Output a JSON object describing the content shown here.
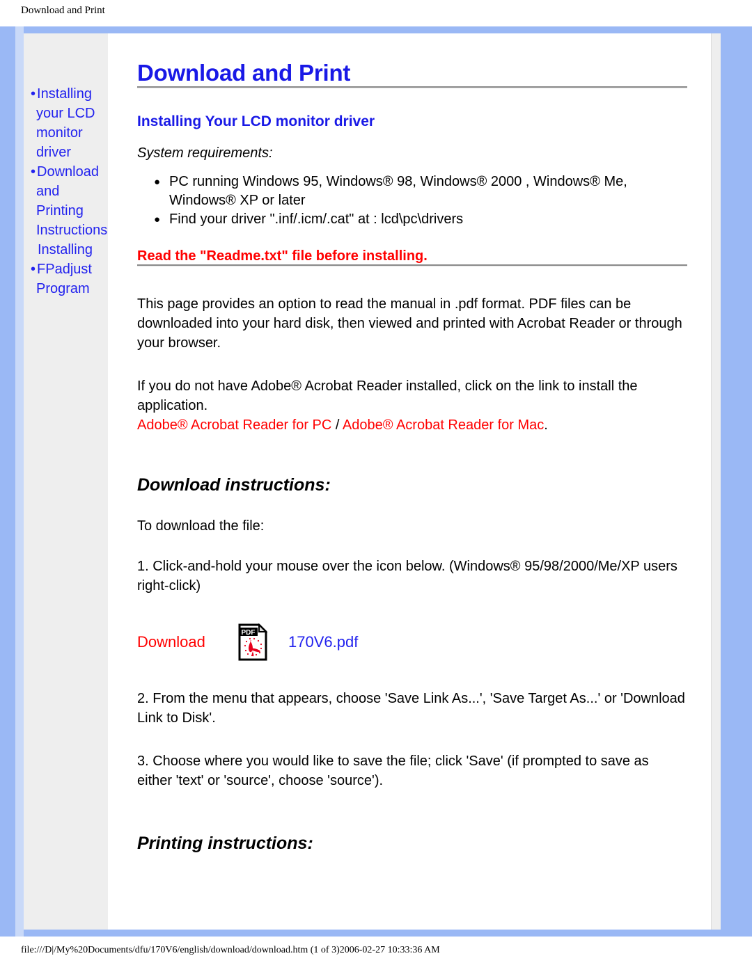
{
  "document_header": "Download and Print",
  "colors": {
    "frame_blue": "#9ab8f5",
    "link_blue": "#2222ee",
    "heading_blue": "#1919e6",
    "warning_red": "#ff0000",
    "sidebar_grey": "#eeeeee"
  },
  "sidebar": {
    "items": [
      {
        "label": "Installing your LCD monitor driver"
      },
      {
        "label": "Download and Printing Instructions"
      },
      {
        "label": "FPadjust Program"
      }
    ],
    "extra_link": "Installing"
  },
  "main": {
    "title": "Download and Print",
    "section_heading": "Installing Your LCD monitor driver",
    "system_requirements_label": "System requirements:",
    "requirements": [
      "PC running Windows 95, Windows® 98, Windows® 2000 , Windows® Me, Windows® XP or later",
      "Find your driver \".inf/.icm/.cat\" at : lcd\\pc\\drivers"
    ],
    "readme_warning": "Read the \"Readme.txt\" file before installing.",
    "intro_paragraph": "This page provides an option to read the manual in .pdf format. PDF files can be downloaded into your hard disk, then viewed and printed with Acrobat Reader or through your browser.",
    "acrobat_paragraph": "If you do not have Adobe® Acrobat Reader installed, click on the link to install the application.",
    "acrobat_links": {
      "pc": "Adobe® Acrobat Reader for PC",
      "separator": " / ",
      "mac": "Adobe® Acrobat Reader for Mac",
      "period": "."
    },
    "download_instructions_heading": "Download instructions:",
    "download_lead": "To download the file:",
    "download_step_1": "1. Click-and-hold your mouse over the icon below. (Windows® 95/98/2000/Me/XP users right-click)",
    "download_link": {
      "label": "Download",
      "icon": "pdf-file-icon",
      "icon_badge": "PDF",
      "filename": "170V6.pdf"
    },
    "download_step_2": "2. From the menu that appears, choose 'Save Link As...', 'Save Target As...' or 'Download Link to Disk'.",
    "download_step_3": "3. Choose where you would like to save the file; click 'Save' (if prompted to save as either 'text' or 'source', choose 'source').",
    "printing_instructions_heading": "Printing instructions:"
  },
  "footer": "file:///D|/My%20Documents/dfu/170V6/english/download/download.htm (1 of 3)2006-02-27 10:33:36 AM"
}
